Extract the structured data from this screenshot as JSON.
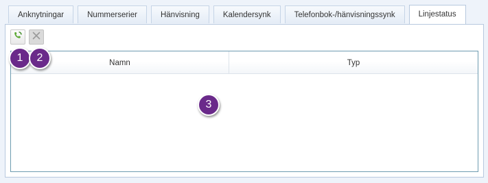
{
  "tabs": [
    {
      "label": "Anknytningar"
    },
    {
      "label": "Nummerserier"
    },
    {
      "label": "Hänvisning"
    },
    {
      "label": "Kalendersynk"
    },
    {
      "label": "Telefonbok-/hänvisningssynk"
    },
    {
      "label": "Linjestatus"
    }
  ],
  "active_tab": "Linjestatus",
  "toolbar": {
    "buttons": [
      {
        "icon": "phone-refresh-icon",
        "enabled": true,
        "color": "#5aa832"
      },
      {
        "icon": "close-icon",
        "enabled": false,
        "color": "#9a9a9a"
      }
    ]
  },
  "grid": {
    "columns": [
      {
        "label": "Namn"
      },
      {
        "label": "Typ"
      }
    ],
    "rows": []
  },
  "callouts": [
    "1",
    "2",
    "3"
  ],
  "colors": {
    "callout": "#6a2a8a",
    "grid_border": "#6d9bb0",
    "panel_border": "#b7c8de"
  }
}
